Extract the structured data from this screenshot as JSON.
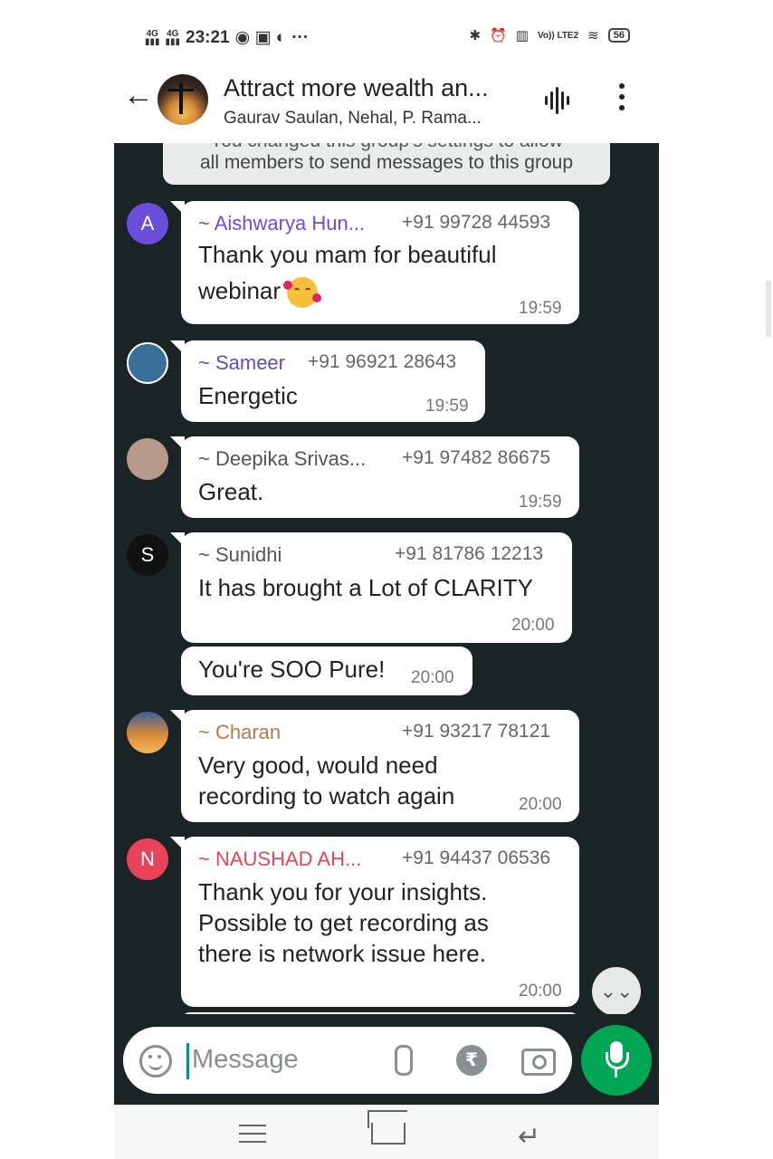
{
  "status_bar": {
    "network_1": "4G",
    "network_2": "4G",
    "time": "23:21",
    "extra": "···",
    "volte": "Vo)) LTE2",
    "battery": "56"
  },
  "header": {
    "title": "Attract more wealth an...",
    "subtitle": "Gaurav Saulan, Nehal, P. Rama..."
  },
  "system_message": {
    "line1": "You changed this group's settings to allow",
    "line2": "all members to send messages to this group"
  },
  "messages": [
    {
      "avatar_letter": "A",
      "avatar_color": "#6a4ddb",
      "name": "~ Aishwarya Hun...",
      "name_color": "#6a4ddb",
      "phone": "+91 99728 44593",
      "lines": [
        "Thank you mam for beautiful",
        "webinar"
      ],
      "emoji": "smiling-face-with-hearts",
      "time": "19:59"
    },
    {
      "avatar_letter": "",
      "avatar_color": "#3a6f9a",
      "name": "~ Sameer",
      "name_color": "#5a4fc7",
      "phone": "+91 96921 28643",
      "lines": [
        "Energetic"
      ],
      "time": "19:59"
    },
    {
      "avatar_letter": "",
      "avatar_color": "#b89a8a",
      "name": "~ Deepika Srivas...",
      "name_color": "#555555",
      "phone": "+91 97482 86675",
      "lines": [
        "Great."
      ],
      "time": "19:59"
    },
    {
      "avatar_letter": "S",
      "avatar_color": "#111111",
      "name": "~ Sunidhi",
      "name_color": "#555555",
      "phone": "+91 81786 12213",
      "lines": [
        "It has brought a Lot of CLARITY"
      ],
      "time": "20:00"
    },
    {
      "lines": [
        "You're SOO Pure!"
      ],
      "time": "20:00"
    },
    {
      "avatar_letter": "",
      "avatar_color": "#d98a3a",
      "name": "~ Charan",
      "name_color": "#b07a4f",
      "phone": "+91 93217 78121",
      "lines": [
        "Very good, would need",
        "recording to watch again"
      ],
      "time": "20:00"
    },
    {
      "avatar_letter": "N",
      "avatar_color": "#e8435a",
      "name": "~ NAUSHAD AH...",
      "name_color": "#e04858",
      "phone": "+91 94437 06536",
      "lines": [
        "Thank you for your insights.",
        "Possible to get recording as",
        "there is network issue here."
      ],
      "time": "20:00"
    }
  ],
  "input": {
    "placeholder": "Message",
    "rupee": "₹"
  },
  "colors": {
    "chat_bg": "#1b2425",
    "bubble": "#ffffff",
    "mic_button": "#00a654"
  },
  "icons": [
    "back-arrow-icon",
    "group-avatar",
    "voice-chat-icon",
    "more-options-icon",
    "emoji-icon",
    "attach-icon",
    "payment-icon",
    "camera-icon",
    "mic-icon",
    "scroll-down-icon"
  ]
}
